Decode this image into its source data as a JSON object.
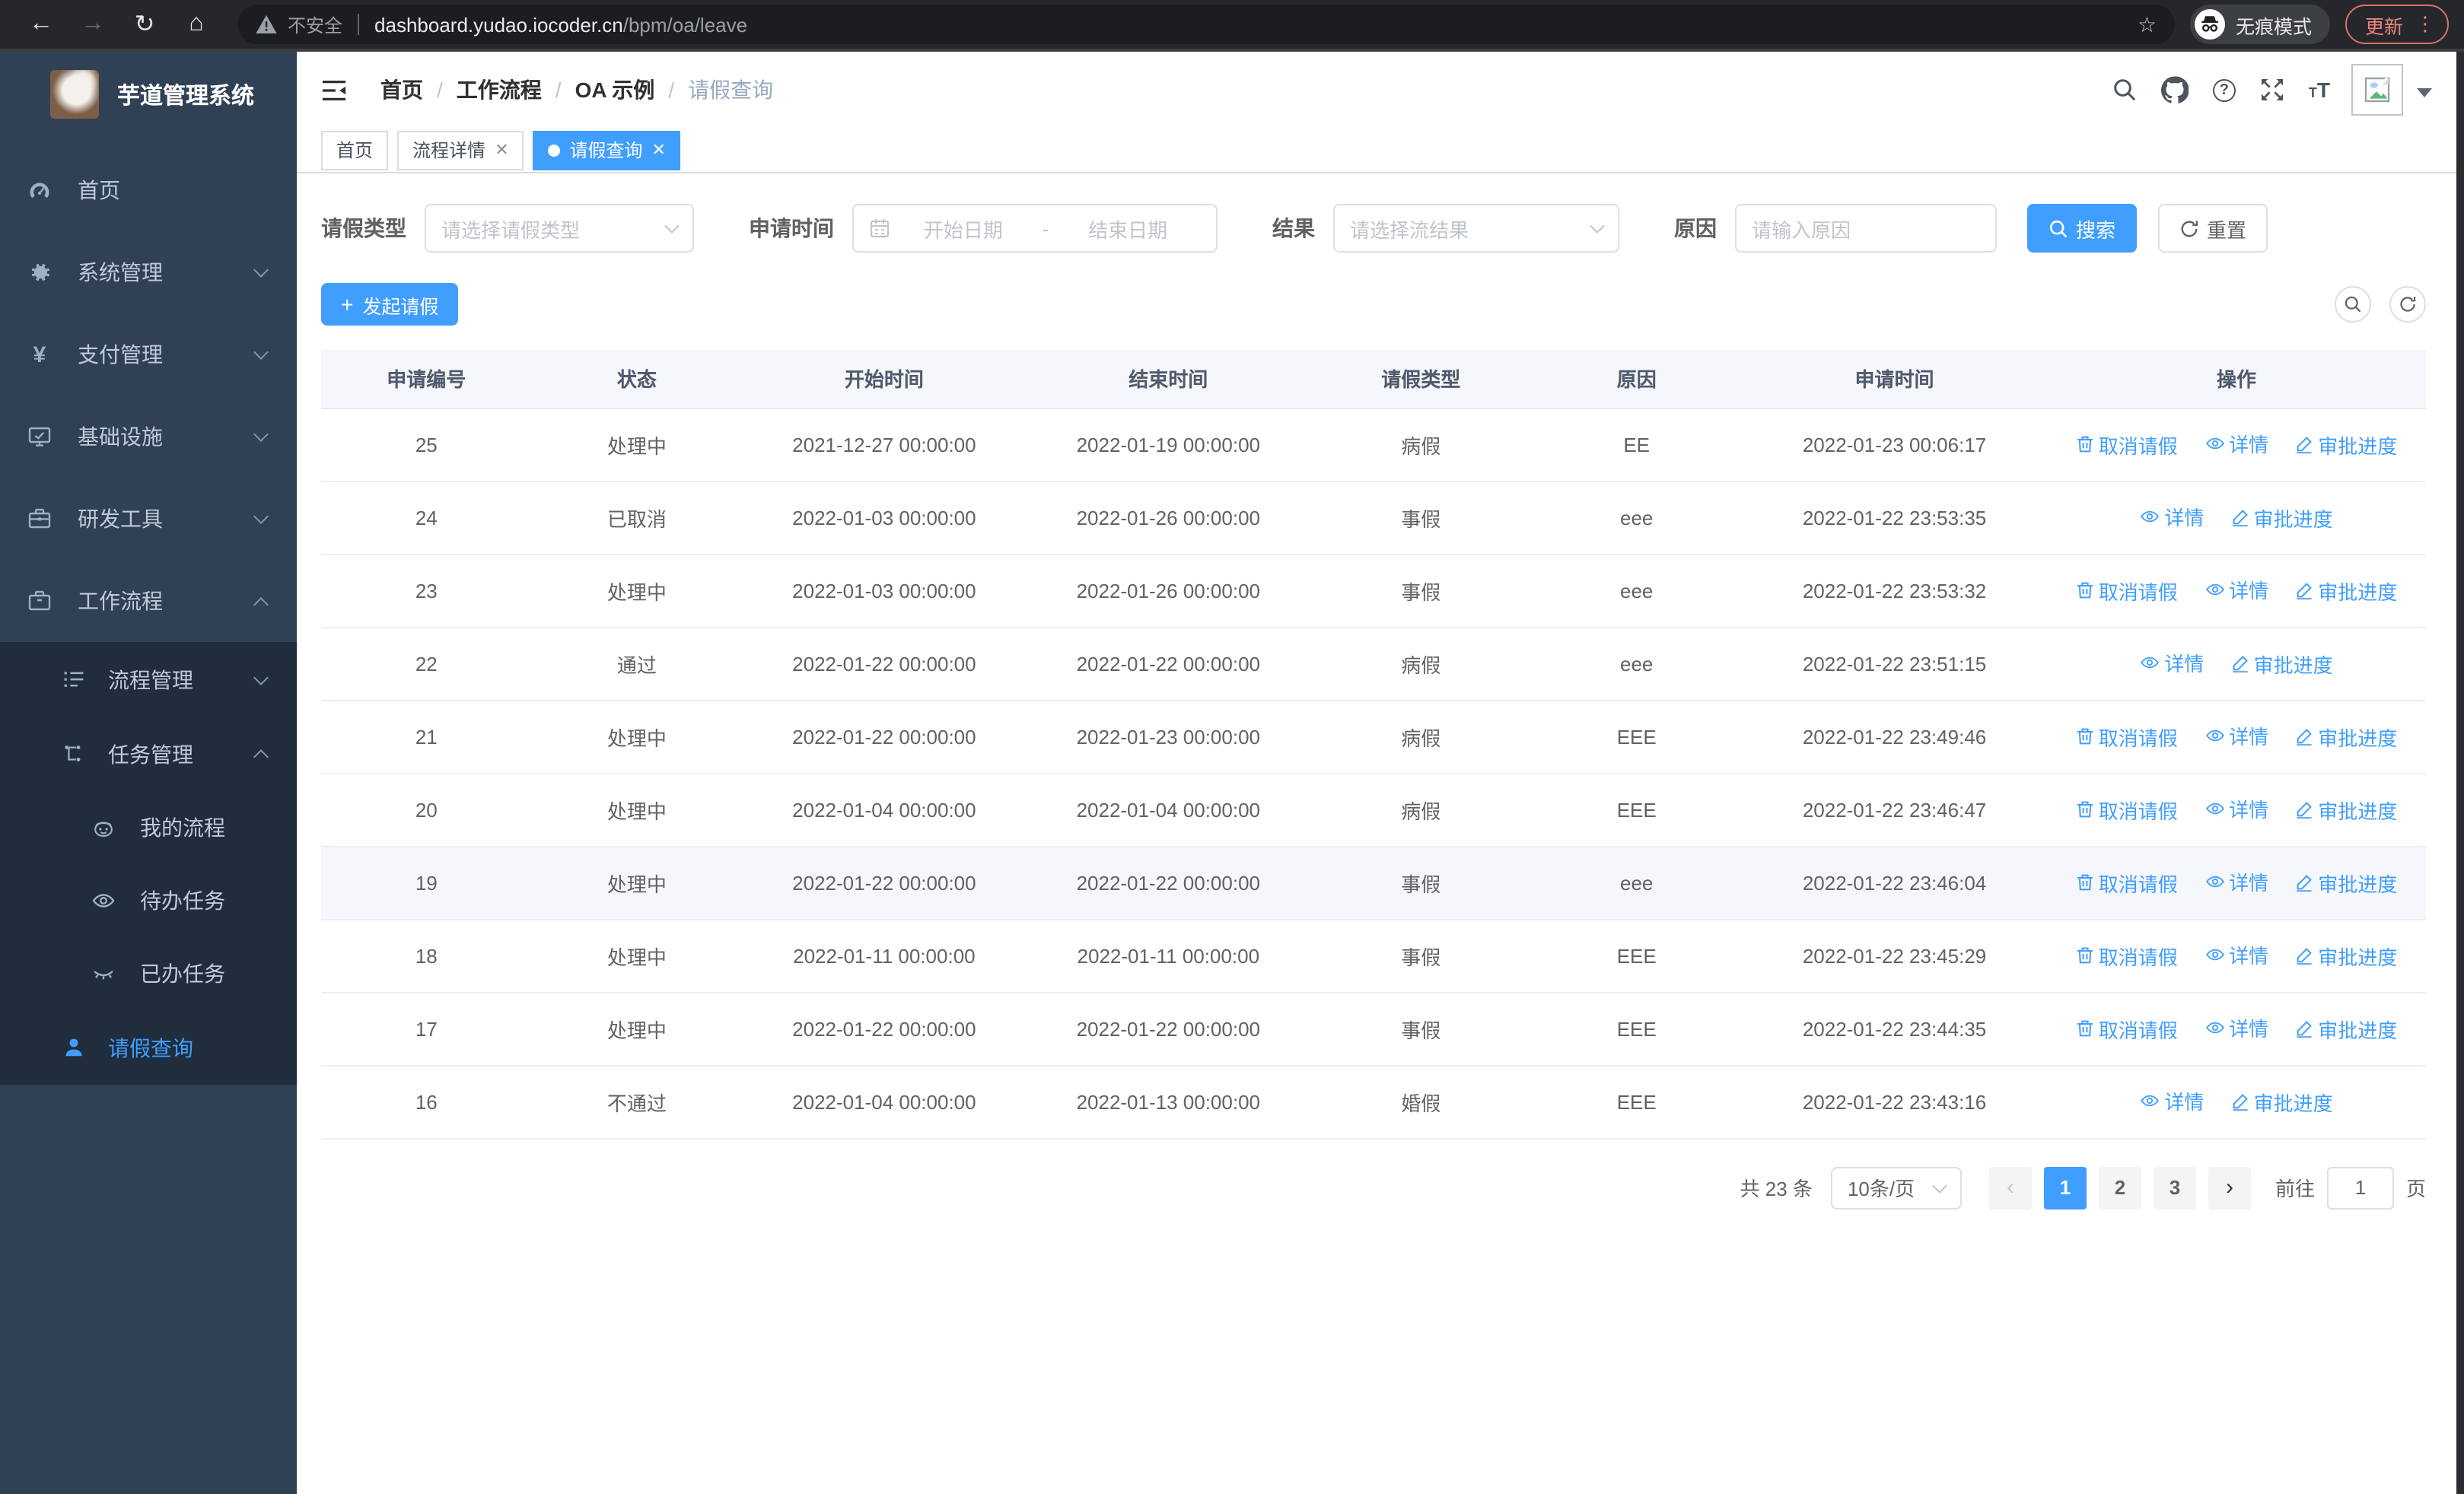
{
  "browser": {
    "security_label": "不安全",
    "url_host": "dashboard.yudao.iocoder.cn",
    "url_path": "/bpm/oa/leave",
    "incognito_label": "无痕模式",
    "update_label": "更新"
  },
  "sidebar": {
    "title": "芋道管理系统",
    "menu": [
      {
        "label": "首页"
      },
      {
        "label": "系统管理"
      },
      {
        "label": "支付管理"
      },
      {
        "label": "基础设施"
      },
      {
        "label": "研发工具"
      },
      {
        "label": "工作流程"
      }
    ],
    "workflow": {
      "process_mgmt": "流程管理",
      "task_mgmt": "任务管理",
      "my_process": "我的流程",
      "todo_tasks": "待办任务",
      "done_tasks": "已办任务",
      "leave_query": "请假查询"
    }
  },
  "header": {
    "breadcrumb": [
      "首页",
      "工作流程",
      "OA 示例",
      "请假查询"
    ]
  },
  "tabs": [
    {
      "label": "首页"
    },
    {
      "label": "流程详情"
    },
    {
      "label": "请假查询"
    }
  ],
  "filters": {
    "leave_type_label": "请假类型",
    "leave_type_placeholder": "请选择请假类型",
    "apply_time_label": "申请时间",
    "start_date_placeholder": "开始日期",
    "date_separator": "-",
    "end_date_placeholder": "结束日期",
    "result_label": "结果",
    "result_placeholder": "请选择流结果",
    "reason_label": "原因",
    "reason_placeholder": "请输入原因",
    "search_label": "搜索",
    "reset_label": "重置"
  },
  "toolbar": {
    "create_label": "发起请假"
  },
  "table": {
    "columns": [
      "申请编号",
      "状态",
      "开始时间",
      "结束时间",
      "请假类型",
      "原因",
      "申请时间",
      "操作"
    ],
    "actions": {
      "cancel": "取消请假",
      "detail": "详情",
      "progress": "审批进度"
    },
    "rows": [
      {
        "id": "25",
        "status": "处理中",
        "start": "2021-12-27 00:00:00",
        "end": "2022-01-19 00:00:00",
        "type": "病假",
        "reason": "EE",
        "apply_time": "2022-01-23 00:06:17",
        "can_cancel": true
      },
      {
        "id": "24",
        "status": "已取消",
        "start": "2022-01-03 00:00:00",
        "end": "2022-01-26 00:00:00",
        "type": "事假",
        "reason": "eee",
        "apply_time": "2022-01-22 23:53:35",
        "can_cancel": false
      },
      {
        "id": "23",
        "status": "处理中",
        "start": "2022-01-03 00:00:00",
        "end": "2022-01-26 00:00:00",
        "type": "事假",
        "reason": "eee",
        "apply_time": "2022-01-22 23:53:32",
        "can_cancel": true
      },
      {
        "id": "22",
        "status": "通过",
        "start": "2022-01-22 00:00:00",
        "end": "2022-01-22 00:00:00",
        "type": "病假",
        "reason": "eee",
        "apply_time": "2022-01-22 23:51:15",
        "can_cancel": false
      },
      {
        "id": "21",
        "status": "处理中",
        "start": "2022-01-22 00:00:00",
        "end": "2022-01-23 00:00:00",
        "type": "病假",
        "reason": "EEE",
        "apply_time": "2022-01-22 23:49:46",
        "can_cancel": true
      },
      {
        "id": "20",
        "status": "处理中",
        "start": "2022-01-04 00:00:00",
        "end": "2022-01-04 00:00:00",
        "type": "病假",
        "reason": "EEE",
        "apply_time": "2022-01-22 23:46:47",
        "can_cancel": true
      },
      {
        "id": "19",
        "status": "处理中",
        "start": "2022-01-22 00:00:00",
        "end": "2022-01-22 00:00:00",
        "type": "事假",
        "reason": "eee",
        "apply_time": "2022-01-22 23:46:04",
        "can_cancel": true,
        "highlighted": true
      },
      {
        "id": "18",
        "status": "处理中",
        "start": "2022-01-11 00:00:00",
        "end": "2022-01-11 00:00:00",
        "type": "事假",
        "reason": "EEE",
        "apply_time": "2022-01-22 23:45:29",
        "can_cancel": true
      },
      {
        "id": "17",
        "status": "处理中",
        "start": "2022-01-22 00:00:00",
        "end": "2022-01-22 00:00:00",
        "type": "事假",
        "reason": "EEE",
        "apply_time": "2022-01-22 23:44:35",
        "can_cancel": true
      },
      {
        "id": "16",
        "status": "不通过",
        "start": "2022-01-04 00:00:00",
        "end": "2022-01-13 00:00:00",
        "type": "婚假",
        "reason": "EEE",
        "apply_time": "2022-01-22 23:43:16",
        "can_cancel": false
      }
    ]
  },
  "pagination": {
    "total_label": "共 23 条",
    "page_size": "10条/页",
    "pages": [
      "1",
      "2",
      "3"
    ],
    "active_page": "1",
    "goto_label": "前往",
    "goto_value": "1",
    "goto_suffix": "页"
  },
  "colors": {
    "primary": "#409EFF",
    "sidebar_bg": "#304156",
    "submenu_bg": "#1F2D3D",
    "browser_bar_bg": "#26272B",
    "update_accent": "#EE8680",
    "table_header_bg": "#F5F7FA"
  }
}
